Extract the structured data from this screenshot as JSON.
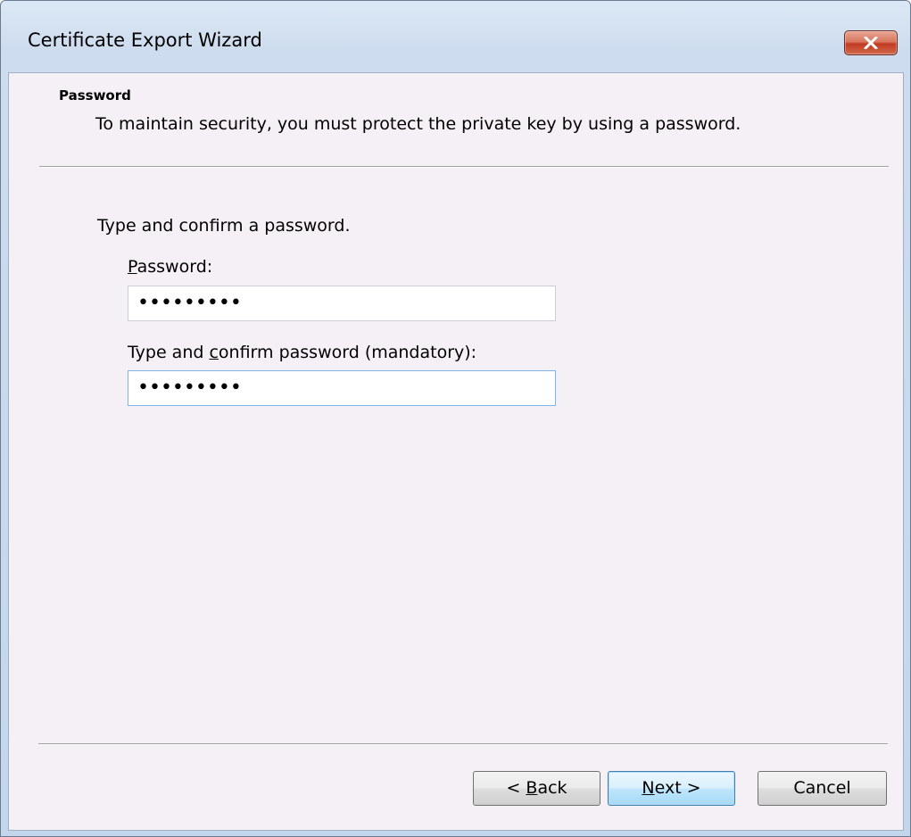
{
  "window": {
    "title": "Certificate Export Wizard"
  },
  "header": {
    "title": "Password",
    "description": "To maintain security, you must protect the private key by using a password."
  },
  "form": {
    "instruction": "Type and confirm a password.",
    "password": {
      "label_mnemonic": "P",
      "label_rest": "assword:",
      "value": "•••••••••"
    },
    "confirm": {
      "label_pre": "Type and ",
      "label_mnemonic": "c",
      "label_rest": "onfirm password (mandatory):",
      "value": "•••••••••"
    }
  },
  "buttons": {
    "back": {
      "prefix": "< ",
      "mnemonic": "B",
      "rest": "ack"
    },
    "next": {
      "mnemonic": "N",
      "rest": "ext >"
    },
    "cancel": {
      "label": "Cancel"
    }
  },
  "colors": {
    "client_background": "#f5f0f5",
    "close_button": "#c23a22",
    "default_button_border": "#3c7fb1"
  }
}
